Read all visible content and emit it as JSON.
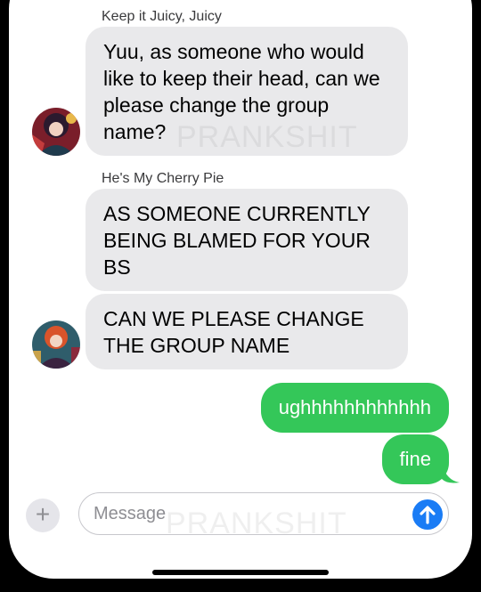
{
  "conversation": {
    "groups": [
      {
        "sender": "Keep it Juicy, Juicy",
        "messages": [
          "Yuu, as someone who would like to keep their head, can we please change the group name?"
        ]
      },
      {
        "sender": "He's My Cherry Pie",
        "messages": [
          "AS SOMEONE CURRENTLY BEING BLAMED FOR YOUR BS",
          "CAN WE PLEASE CHANGE THE GROUP NAME"
        ]
      }
    ],
    "outgoing": [
      "ughhhhhhhhhhhh",
      "fine"
    ]
  },
  "watermark": "PRANKSHIT",
  "input": {
    "placeholder": "Message",
    "plus_icon": "plus-icon",
    "send_icon": "arrow-up-icon"
  },
  "colors": {
    "incoming_bubble": "#e9e9eb",
    "outgoing_bubble": "#34c759",
    "send_button": "#1a7cf5"
  }
}
